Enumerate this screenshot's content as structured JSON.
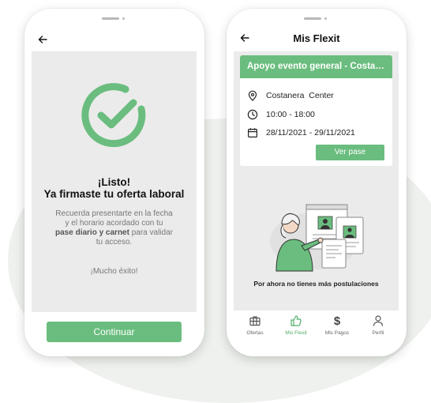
{
  "colors": {
    "accent": "#6abd7e",
    "background_screen": "#ebebeb"
  },
  "left_phone": {
    "back_icon": "arrow-left-icon",
    "success_icon": "check-circle-icon",
    "title_line1": "¡Listo!",
    "title_line2": "Ya firmaste tu oferta laboral",
    "body_line1": "Recuerda presentarte en la fecha",
    "body_line2": "y el horario acordado con tu",
    "body_bold": "pase diario y carnet",
    "body_line3_after": " para validar",
    "body_line4": "tu acceso.",
    "farewell": "¡Mucho éxito!",
    "continue_label": "Continuar"
  },
  "right_phone": {
    "back_icon": "arrow-left-icon",
    "title": "Mis Flexit",
    "card": {
      "title": "Apoyo evento general - Costanera Center",
      "location": "Costanera  Center",
      "time": "10:00 - 18:00",
      "dates": "28/11/2021 - 29/11/2021",
      "button_label": "Ver pase"
    },
    "empty_message": "Por ahora no tienes más postulaciones",
    "nav": [
      {
        "label": "Ofertas",
        "icon": "briefcase-icon",
        "active": false
      },
      {
        "label": "Mis Flexit",
        "icon": "thumbs-up-icon",
        "active": true
      },
      {
        "label": "Mis Pagos",
        "icon": "dollar-icon",
        "active": false
      },
      {
        "label": "Perfil",
        "icon": "user-icon",
        "active": false
      }
    ]
  }
}
